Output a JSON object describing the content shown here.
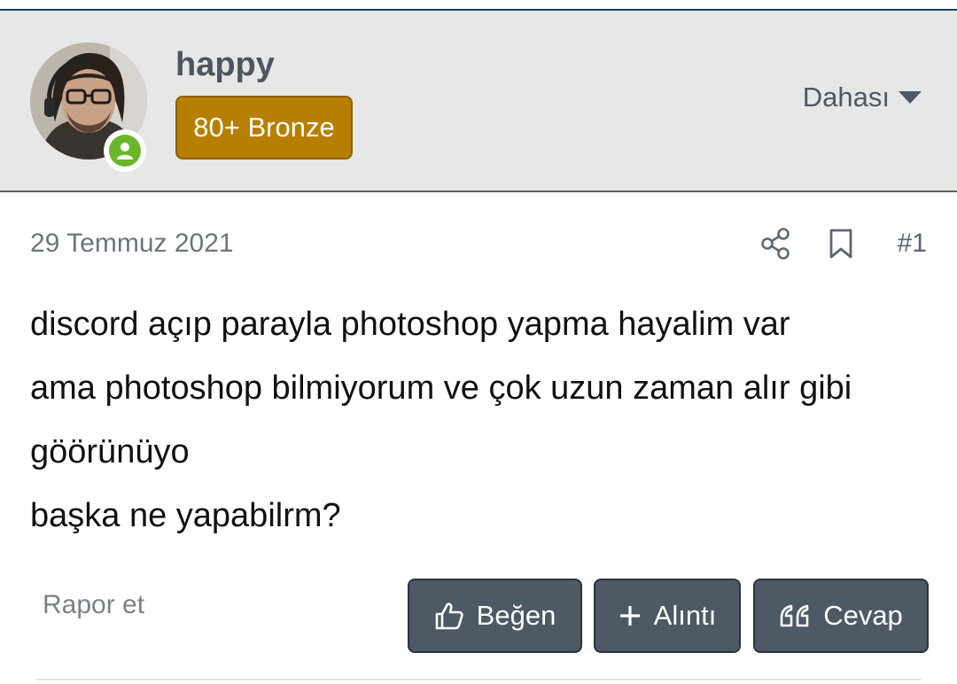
{
  "author": {
    "username": "happy",
    "rank_badge": "80+ Bronze",
    "more_menu_label": "Dahası",
    "online_status": "online"
  },
  "post": {
    "date": "29 Temmuz 2021",
    "number": "#1",
    "lines": [
      "discord açıp parayla photoshop yapma hayalim var",
      "ama photoshop bilmiyorum ve çok uzun zaman alır gibi",
      "göörünüyo",
      "başka ne yapabilrm?"
    ]
  },
  "actions": {
    "report_label": "Rapor et",
    "like_label": "Beğen",
    "quote_label": "Alıntı",
    "reply_label": "Cevap"
  },
  "colors": {
    "header_bg": "#e7e7e7",
    "badge_bg": "#b77f02",
    "online_green": "#6bb52a",
    "button_bg": "#4d5965"
  },
  "icons": [
    "share-icon",
    "bookmark-icon",
    "thumbs-up-icon",
    "plus-icon",
    "quote-icon",
    "caret-down-icon",
    "user-online-icon"
  ]
}
